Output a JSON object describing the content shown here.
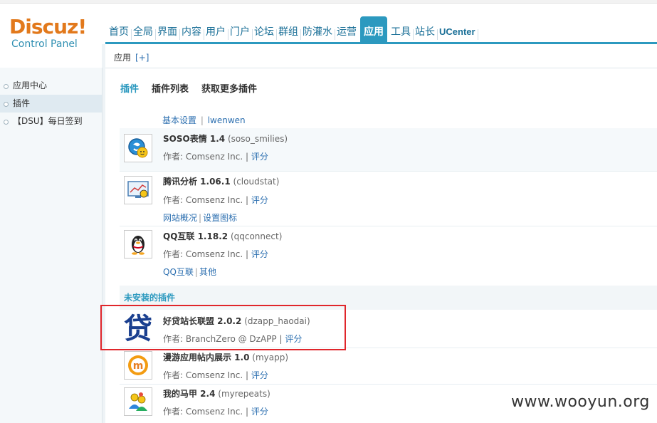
{
  "logo": {
    "main_part1": "Discuz",
    "main_part2": "!",
    "sub": "Control Panel"
  },
  "nav": [
    {
      "label": "首页"
    },
    {
      "label": "全局"
    },
    {
      "label": "界面"
    },
    {
      "label": "内容"
    },
    {
      "label": "用户"
    },
    {
      "label": "门户"
    },
    {
      "label": "论坛"
    },
    {
      "label": "群组"
    },
    {
      "label": "防灌水"
    },
    {
      "label": "运营"
    },
    {
      "label": "应用",
      "active": true
    },
    {
      "label": "工具"
    },
    {
      "label": "站长"
    },
    {
      "label": "UCenter"
    }
  ],
  "subheader": {
    "title": "应用",
    "plus": "[+]"
  },
  "sidebar": {
    "items": [
      {
        "label": "应用中心"
      },
      {
        "label": "插件"
      },
      {
        "label": "【DSU】每日签到"
      }
    ]
  },
  "tabs": [
    {
      "label": "插件"
    },
    {
      "label": "插件列表"
    },
    {
      "label": "获取更多插件"
    }
  ],
  "top_links": {
    "a": "基本设置",
    "sep": "|",
    "b": "lwenwen"
  },
  "installed": [
    {
      "name": "SOSO表情 1.4",
      "id": "(soso_smilies)",
      "author": "作者: Comsenz Inc.",
      "sep": "|",
      "rate": "评分",
      "icon": "soso-smile-icon",
      "links": []
    },
    {
      "name": "腾讯分析 1.06.1",
      "id": "(cloudstat)",
      "author": "作者: Comsenz Inc.",
      "sep": "|",
      "rate": "评分",
      "icon": "analytics-icon",
      "links": [
        "网站概况",
        "设置图标"
      ]
    },
    {
      "name": "QQ互联 1.18.2",
      "id": "(qqconnect)",
      "author": "作者: Comsenz Inc.",
      "sep": "|",
      "rate": "评分",
      "icon": "qq-penguin-icon",
      "links": [
        "QQ互联",
        "其他"
      ]
    }
  ],
  "uninstalled_title": "未安装的插件",
  "uninstalled": [
    {
      "name": "好贷站长联盟 2.0.2",
      "id": "(dzapp_haodai)",
      "author": "作者: BranchZero @ DzAPP",
      "sep": "|",
      "rate": "评分",
      "icon": "haodai-logo-icon",
      "icon_char": "贷"
    },
    {
      "name": "漫游应用帖内展示 1.0",
      "id": "(myapp)",
      "author": "作者: Comsenz Inc.",
      "sep": "|",
      "rate": "评分",
      "icon": "myapp-m-icon",
      "icon_char": "m"
    },
    {
      "name": "我的马甲 2.4",
      "id": "(myrepeats)",
      "author": "作者: Comsenz Inc.",
      "sep": "|",
      "rate": "评分",
      "icon": "users-icon"
    }
  ],
  "watermark": "www.wooyun.org",
  "colors": {
    "accent": "#2c99bf",
    "logo": "#e2791c",
    "highlight_box": "#e0262b",
    "link": "#2c6fb0"
  }
}
